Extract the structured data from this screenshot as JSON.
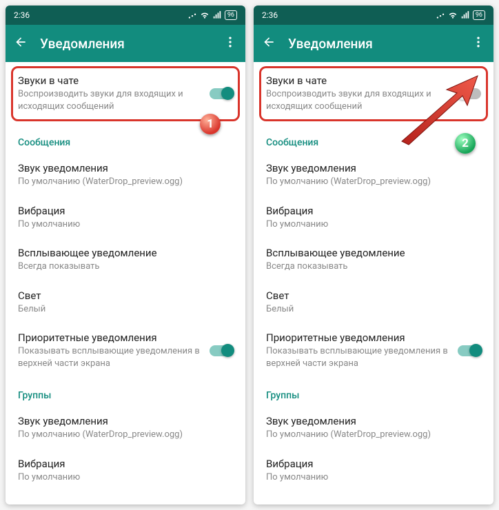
{
  "status": {
    "time": "2:36",
    "battery": "96"
  },
  "topbar": {
    "title": "Уведомления"
  },
  "chatSounds": {
    "title": "Звуки в чате",
    "desc": "Воспроизводить звуки для входящих и исходящих сообщений"
  },
  "sections": {
    "messages": "Сообщения",
    "groups": "Группы"
  },
  "rows": {
    "notifSound": {
      "t1": "Звук уведомления",
      "t2": "По умолчанию (WaterDrop_preview.ogg)"
    },
    "vibration": {
      "t1": "Вибрация",
      "t2": "По умолчанию"
    },
    "popup": {
      "t1": "Всплывающее уведомление",
      "t2": "Всегда показывать"
    },
    "light": {
      "t1": "Свет",
      "t2": "Белый"
    },
    "priority": {
      "t1": "Приоритетные уведомления",
      "t2": "Показывать всплывающие уведомления в верхней части экрана"
    },
    "grpSound": {
      "t1": "Звук уведомления",
      "t2": "По умолчанию (WaterDrop_preview.ogg)"
    },
    "grpVibration": {
      "t1": "Вибрация",
      "t2": "По умолчанию"
    }
  },
  "callouts": {
    "one": "1",
    "two": "2"
  }
}
